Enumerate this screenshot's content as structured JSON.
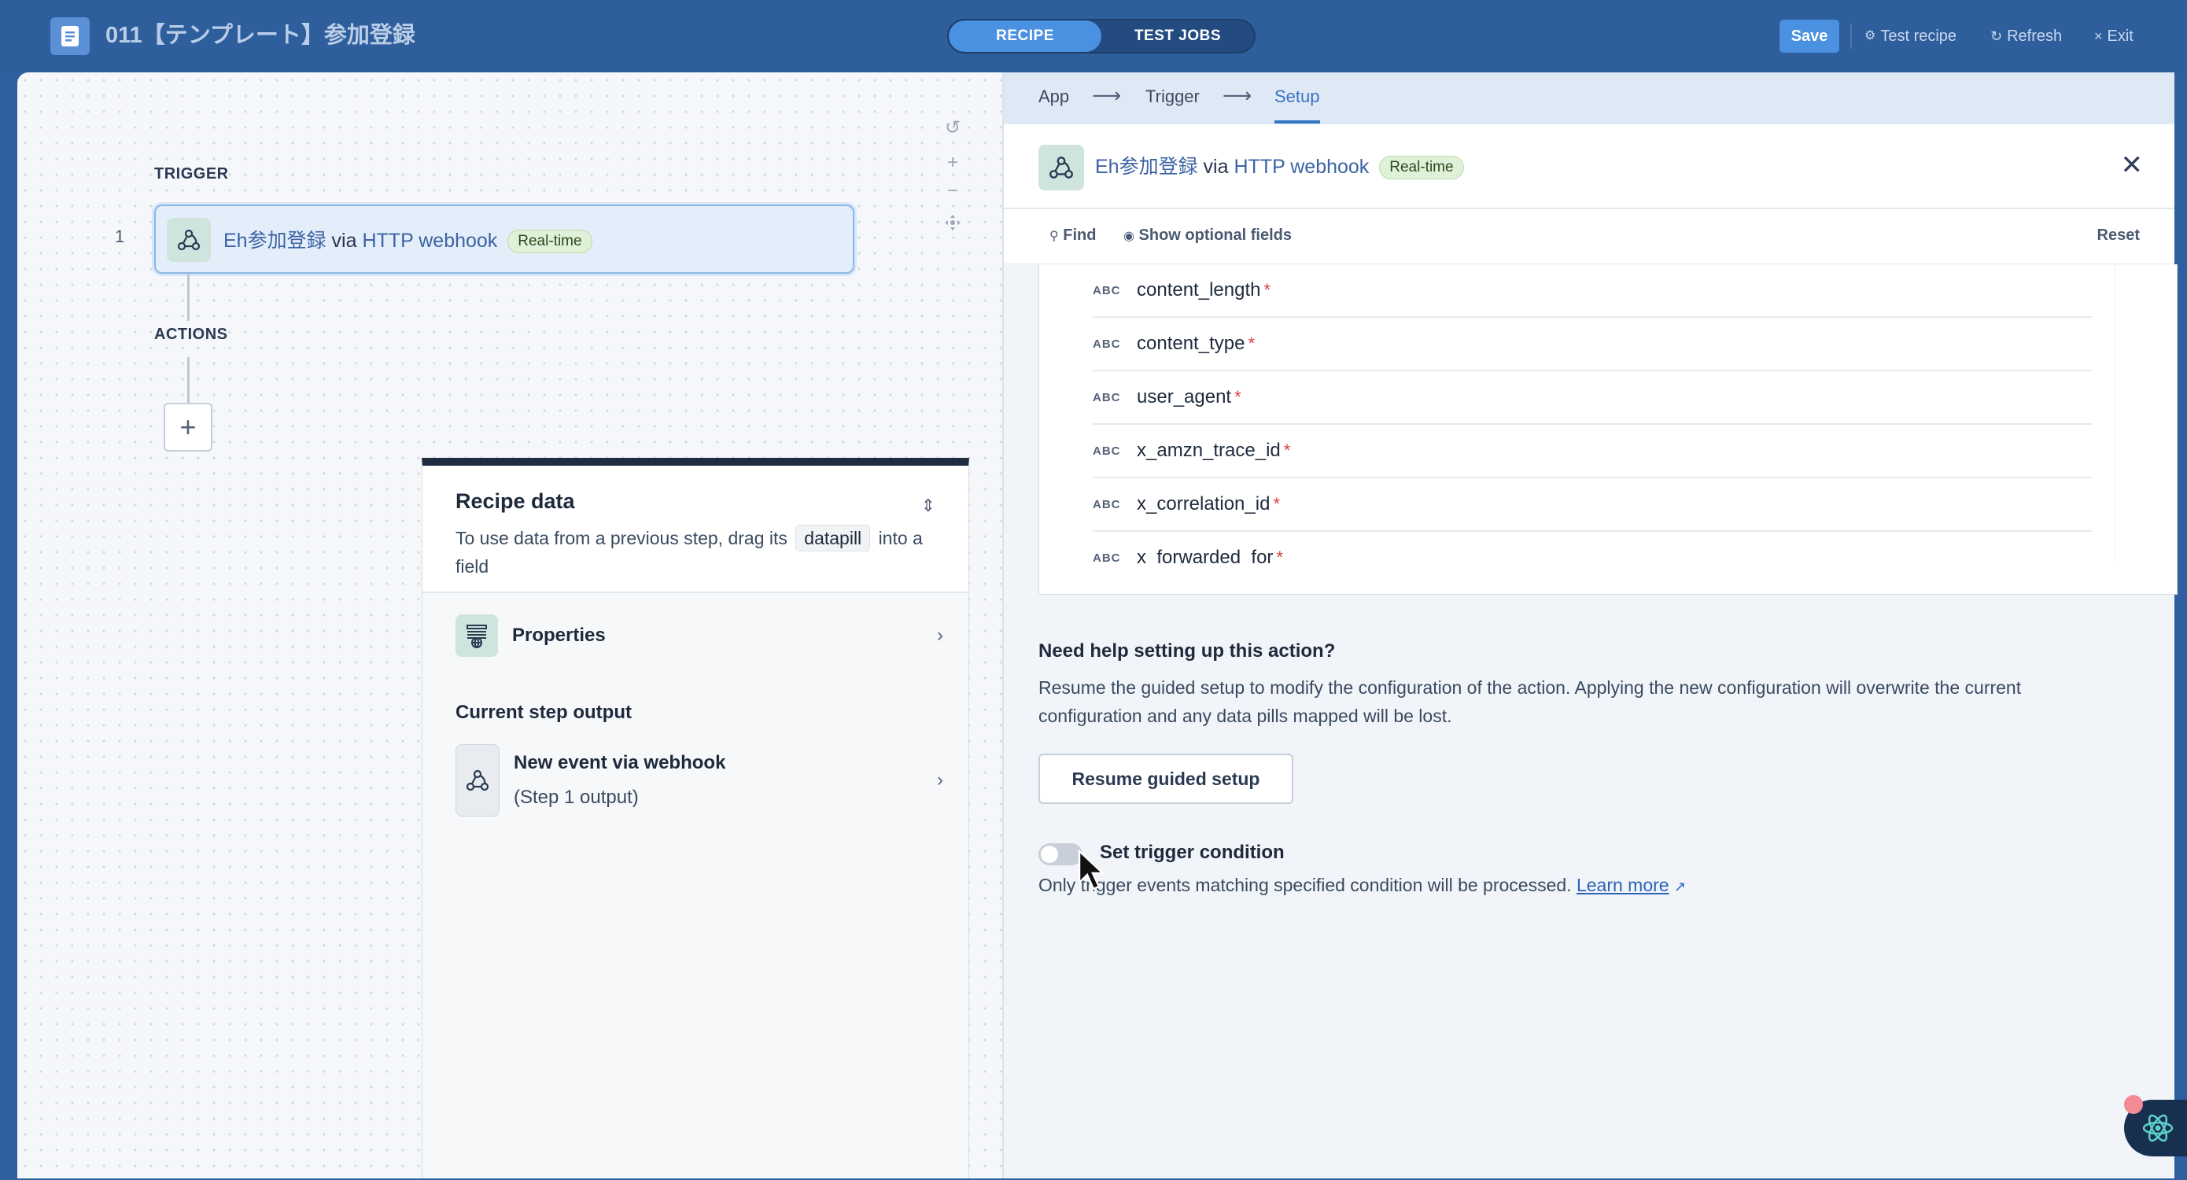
{
  "topbar": {
    "recipe_title": "011【テンプレート】参加登録",
    "tabs": [
      {
        "label": "RECIPE",
        "active": true
      },
      {
        "label": "TEST JOBS",
        "active": false
      }
    ],
    "save_label": "Save",
    "test_recipe_label": "Test recipe",
    "refresh_label": "Refresh",
    "exit_label": "Exit"
  },
  "canvas": {
    "trigger_label": "TRIGGER",
    "actions_label": "ACTIONS",
    "step_number": "1",
    "trigger_card": {
      "name": "Eh参加登録",
      "via": "via",
      "connector": "HTTP webhook",
      "badge": "Real-time"
    },
    "add_step_symbol": "+"
  },
  "recipe_data": {
    "title": "Recipe data",
    "desc_before": "To use data from a previous step, drag its",
    "desc_pill": "datapill",
    "desc_after": "into a field",
    "properties_label": "Properties",
    "current_step_output_label": "Current step output",
    "output_item_title": "New event via webhook",
    "output_item_sub": "(Step 1 output)"
  },
  "setup_panel": {
    "breadcrumbs": [
      {
        "label": "App",
        "active": false
      },
      {
        "label": "Trigger",
        "active": false
      },
      {
        "label": "Setup",
        "active": true
      }
    ],
    "header": {
      "name": "Eh参加登録",
      "via": "via",
      "connector": "HTTP webhook",
      "badge": "Real-time"
    },
    "toolbar": {
      "find_label": "Find",
      "optional_fields_label": "Show optional fields",
      "reset_label": "Reset"
    },
    "fields": [
      {
        "type": "ABC",
        "name": "content_length",
        "required": "*"
      },
      {
        "type": "ABC",
        "name": "content_type",
        "required": "*"
      },
      {
        "type": "ABC",
        "name": "user_agent",
        "required": "*"
      },
      {
        "type": "ABC",
        "name": "x_amzn_trace_id",
        "required": "*"
      },
      {
        "type": "ABC",
        "name": "x_correlation_id",
        "required": "*"
      },
      {
        "type": "ABC",
        "name": "x_forwarded_for",
        "required": "*"
      }
    ],
    "help": {
      "title": "Need help setting up this action?",
      "text": "Resume the guided setup to modify the configuration of the action. Applying the new configuration will overwrite the current configuration and any data pills mapped will be lost.",
      "resume_button": "Resume guided setup"
    },
    "trigger_condition": {
      "label": "Set trigger condition",
      "enabled": false,
      "description": "Only trigger events matching specified condition will be processed.",
      "learn_more": "Learn more"
    }
  },
  "colors": {
    "topbar_bg": "#2e5e9c",
    "accent": "#4a91e2",
    "required": "#d93f3f",
    "realtime_badge": "#dff1d8"
  }
}
